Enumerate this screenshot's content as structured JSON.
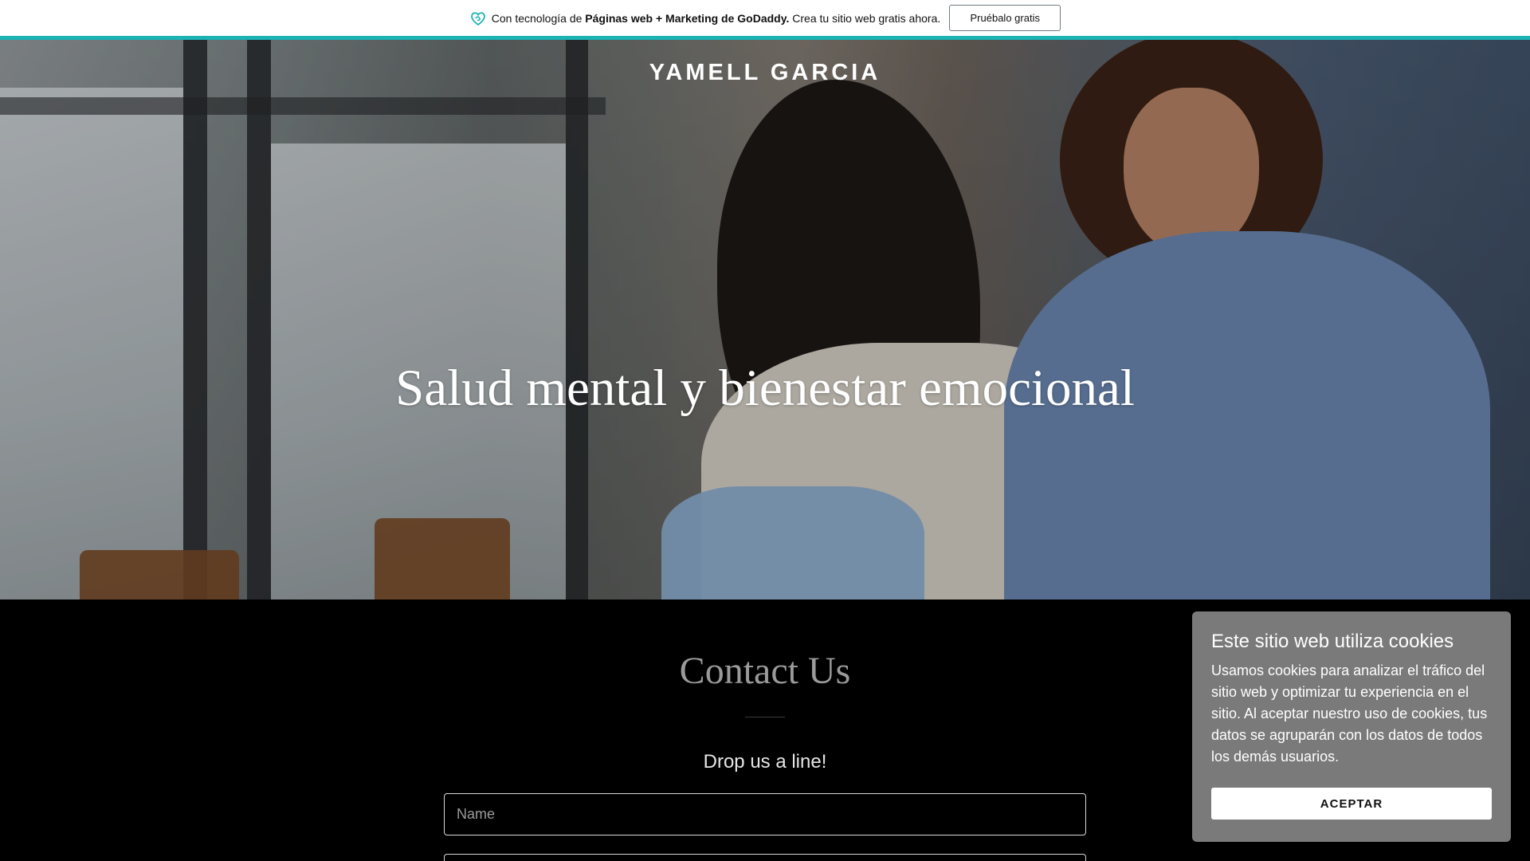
{
  "promo_bar": {
    "prefix": "Con tecnología de",
    "brand": "Páginas web + Marketing de GoDaddy.",
    "suffix": "Crea tu sitio web gratis ahora.",
    "button_label": "Pruébalo gratis",
    "icon": "godaddy-heart-icon",
    "accent_color": "#1bb3b3"
  },
  "header": {
    "site_title": "YAMELL GARCIA"
  },
  "hero": {
    "headline": "Salud mental y bienestar emocional"
  },
  "contact": {
    "title": "Contact Us",
    "subtitle": "Drop us a line!",
    "name_placeholder": "Name"
  },
  "cookie_banner": {
    "title": "Este sitio web utiliza cookies",
    "text": "Usamos cookies para analizar el tráfico del sitio web y optimizar tu experiencia en el sitio. Al aceptar nuestro uso de cookies, tus datos se agruparán con los datos de todos los demás usuarios.",
    "button_label": "ACEPTAR"
  }
}
